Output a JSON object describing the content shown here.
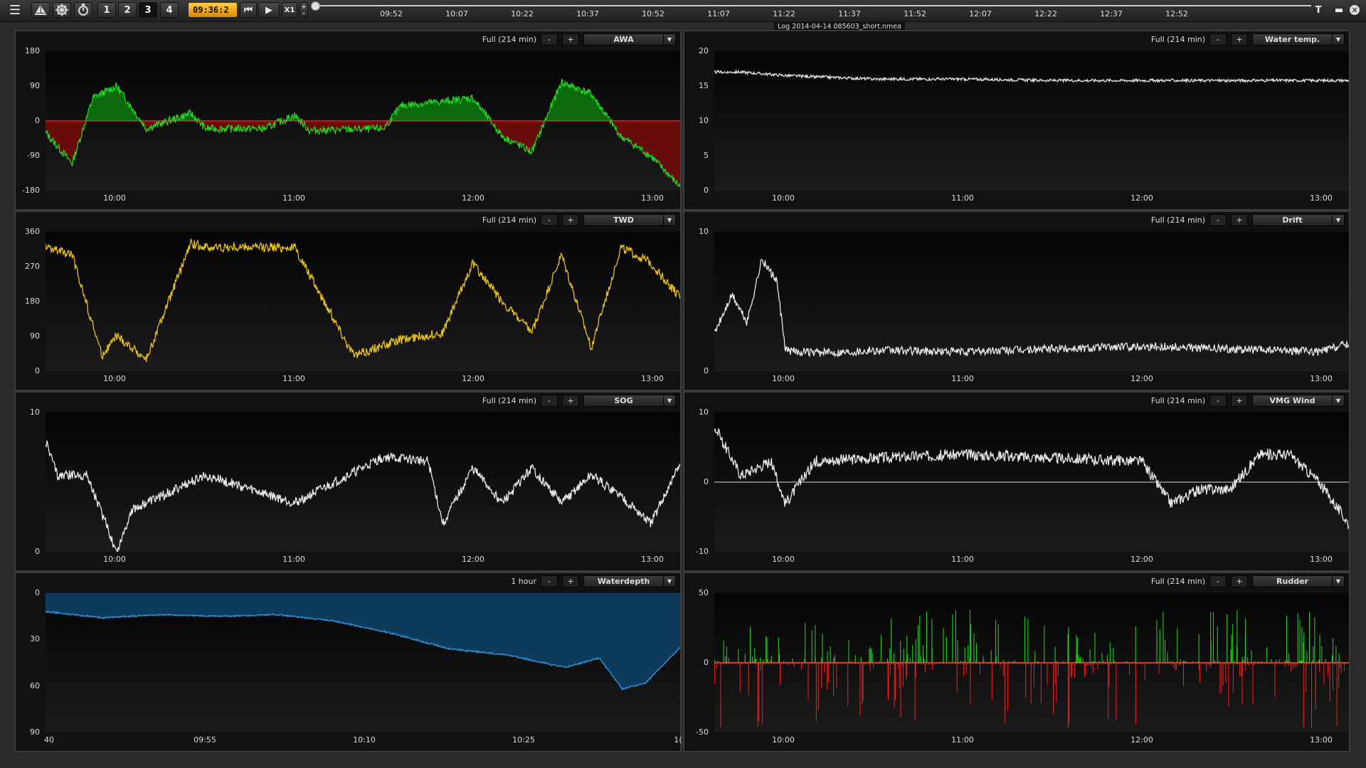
{
  "toolbar": {
    "menu_icon": "hamburger-icon",
    "boat_icon": "sailboat-icon",
    "helm_icon": "helm-icon",
    "timer_icon": "stopwatch-icon",
    "pages": [
      "1",
      "2",
      "3",
      "4"
    ],
    "active_page": "3",
    "clock": "09:36:2",
    "speed": "X1",
    "timeline_ticks": [
      "09:52",
      "10:07",
      "10:22",
      "10:37",
      "10:52",
      "11:07",
      "11:22",
      "11:37",
      "11:52",
      "12:07",
      "12:22",
      "12:37",
      "12:52"
    ],
    "t_label": "T",
    "log_name": "Log 2014-04-14 085603_short.nmea"
  },
  "panels": [
    {
      "id": "awa",
      "range": "Full (214 min)",
      "minus": "-",
      "plus": "+",
      "channel": "AWA",
      "y_ticks": [
        "180",
        "90",
        "0",
        "-90",
        "-180"
      ],
      "x_ticks": [
        "10:00",
        "11:00",
        "12:00",
        "13:00"
      ]
    },
    {
      "id": "water",
      "range": "Full (214 min)",
      "minus": "-",
      "plus": "+",
      "channel": "Water temp.",
      "y_ticks": [
        "20",
        "15",
        "10",
        "5",
        "0"
      ],
      "x_ticks": [
        "10:00",
        "11:00",
        "12:00",
        "13:00"
      ]
    },
    {
      "id": "twd",
      "range": "Full (214 min)",
      "minus": "-",
      "plus": "+",
      "channel": "TWD",
      "y_ticks": [
        "360",
        "270",
        "180",
        "90",
        "0"
      ],
      "x_ticks": [
        "10:00",
        "11:00",
        "12:00",
        "13:00"
      ]
    },
    {
      "id": "drift",
      "range": "Full (214 min)",
      "minus": "-",
      "plus": "+",
      "channel": "Drift",
      "y_ticks": [
        "10",
        "0"
      ],
      "x_ticks": [
        "10:00",
        "11:00",
        "12:00",
        "13:00"
      ]
    },
    {
      "id": "sog",
      "range": "Full (214 min)",
      "minus": "-",
      "plus": "+",
      "channel": "SOG",
      "y_ticks": [
        "10",
        "0"
      ],
      "x_ticks": [
        "10:00",
        "11:00",
        "12:00",
        "13:00"
      ]
    },
    {
      "id": "vmg",
      "range": "Full (214 min)",
      "minus": "-",
      "plus": "+",
      "channel": "VMG Wind",
      "y_ticks": [
        "10",
        "0",
        "-10"
      ],
      "x_ticks": [
        "10:00",
        "11:00",
        "12:00",
        "13:00"
      ]
    },
    {
      "id": "depth",
      "range": "1 hour",
      "minus": "-",
      "plus": "+",
      "channel": "Waterdepth",
      "y_ticks": [
        "0",
        "30",
        "60",
        "90"
      ],
      "x_ticks": [
        "40",
        "09:55",
        "10:10",
        "10:25",
        "1("
      ]
    },
    {
      "id": "rudder",
      "range": "Full (214 min)",
      "minus": "-",
      "plus": "+",
      "channel": "Rudder",
      "y_ticks": [
        "50",
        "0",
        "-50"
      ],
      "x_ticks": [
        "10:00",
        "11:00",
        "12:00",
        "13:00"
      ]
    }
  ],
  "chart_data": [
    {
      "type": "area",
      "name": "AWA",
      "ylim": [
        -180,
        180
      ],
      "x": [
        "09:36",
        "09:45",
        "09:52",
        "10:00",
        "10:10",
        "10:25",
        "10:30",
        "10:50",
        "11:00",
        "11:05",
        "11:30",
        "11:36",
        "11:50",
        "12:00",
        "12:10",
        "12:20",
        "12:30",
        "12:40",
        "12:50",
        "13:00",
        "13:10"
      ],
      "values": [
        -30,
        -110,
        60,
        90,
        -20,
        20,
        -20,
        -20,
        15,
        -25,
        -20,
        40,
        50,
        60,
        -40,
        -80,
        100,
        70,
        -40,
        -90,
        -170
      ]
    },
    {
      "type": "line",
      "name": "Water temp.",
      "ylim": [
        0,
        20
      ],
      "x": [
        "09:36",
        "09:45",
        "10:00",
        "10:30",
        "11:00",
        "11:30",
        "12:00",
        "12:30",
        "13:00",
        "13:10"
      ],
      "values": [
        17,
        17,
        16.5,
        16,
        16,
        15.8,
        15.8,
        15.8,
        15.8,
        15.8
      ]
    },
    {
      "type": "line",
      "name": "TWD",
      "ylim": [
        0,
        360
      ],
      "x": [
        "09:36",
        "09:45",
        "09:55",
        "10:00",
        "10:10",
        "10:25",
        "10:30",
        "10:50",
        "11:00",
        "11:20",
        "11:35",
        "11:50",
        "12:00",
        "12:10",
        "12:20",
        "12:30",
        "12:40",
        "12:50",
        "13:00",
        "13:10"
      ],
      "values": [
        320,
        300,
        40,
        90,
        30,
        330,
        320,
        320,
        320,
        40,
        80,
        100,
        280,
        180,
        100,
        300,
        60,
        320,
        280,
        190
      ]
    },
    {
      "type": "line",
      "name": "Drift",
      "ylim": [
        0,
        10
      ],
      "x": [
        "09:36",
        "09:42",
        "09:47",
        "09:52",
        "09:57",
        "10:00",
        "10:10",
        "10:30",
        "11:00",
        "11:30",
        "12:00",
        "12:30",
        "13:00",
        "13:10"
      ],
      "values": [
        2.7,
        5.5,
        3.5,
        8,
        6.5,
        1.5,
        1.3,
        1.5,
        1.4,
        1.6,
        1.8,
        1.6,
        1.4,
        2
      ]
    },
    {
      "type": "line",
      "name": "SOG",
      "ylim": [
        0,
        10
      ],
      "x": [
        "09:36",
        "09:40",
        "09:50",
        "10:00",
        "10:05",
        "10:30",
        "11:00",
        "11:30",
        "11:45",
        "11:50",
        "12:00",
        "12:10",
        "12:20",
        "12:30",
        "12:40",
        "12:50",
        "13:00",
        "13:10"
      ],
      "values": [
        8,
        5.5,
        5.5,
        0,
        3,
        5.5,
        3.5,
        6.8,
        6.5,
        2,
        6,
        3.5,
        6,
        3.5,
        5.5,
        4,
        2,
        6.3
      ]
    },
    {
      "type": "line",
      "name": "VMG Wind",
      "ylim": [
        -10,
        10
      ],
      "x": [
        "09:36",
        "09:45",
        "09:55",
        "10:00",
        "10:10",
        "10:30",
        "11:00",
        "11:30",
        "12:00",
        "12:10",
        "12:20",
        "12:30",
        "12:40",
        "12:50",
        "13:00",
        "13:10"
      ],
      "values": [
        8,
        1,
        3,
        -3,
        3,
        3.5,
        4,
        3.5,
        3,
        -3,
        -1,
        -1,
        4,
        4,
        0,
        -6
      ]
    },
    {
      "type": "area",
      "name": "Waterdepth",
      "ylim": [
        90,
        0
      ],
      "x": [
        "09:40",
        "09:45",
        "09:50",
        "09:55",
        "10:00",
        "10:05",
        "10:10",
        "10:15",
        "10:20",
        "10:25",
        "10:28",
        "10:30",
        "10:32",
        "10:35"
      ],
      "values": [
        12,
        16,
        14,
        15,
        14,
        18,
        26,
        36,
        40,
        48,
        42,
        62,
        58,
        35
      ]
    },
    {
      "type": "bar",
      "name": "Rudder",
      "ylim": [
        -50,
        50
      ],
      "x": [
        "09:36",
        "10:00",
        "10:30",
        "11:00",
        "11:30",
        "12:00",
        "12:30",
        "13:00",
        "13:10"
      ],
      "values": [
        30,
        -45,
        40,
        -40,
        30,
        -45,
        35,
        -30,
        20
      ]
    }
  ]
}
